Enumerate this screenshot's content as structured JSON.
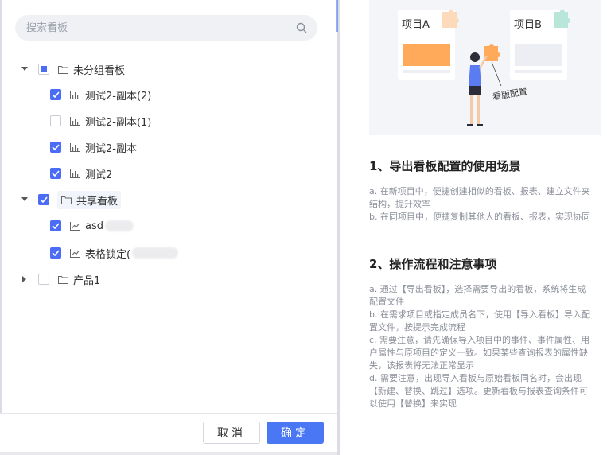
{
  "search": {
    "placeholder": "搜索看板"
  },
  "tree": {
    "groups": [
      {
        "label": "未分组看板",
        "items": [
          "测试2-副本(2)",
          "测试2-副本(1)",
          "测试2-副本",
          "测试2"
        ]
      },
      {
        "label": "共享看板",
        "items": [
          "asd",
          "表格锁定("
        ]
      },
      {
        "label": "产品1",
        "items": []
      }
    ]
  },
  "footer": {
    "cancel_label": "取消",
    "ok_label": "确定"
  },
  "illustration": {
    "card_a": "项目A",
    "card_b": "项目B",
    "caption": "看版配置"
  },
  "guide": {
    "section1_title": "1、导出看板配置的使用场景",
    "section1_lines": [
      "a. 在新项目中，便捷创建相似的看板、报表、建立文件夹结构，提升效率",
      "b. 在同项目中，便捷复制其他人的看板、报表，实现协同"
    ],
    "section2_title": "2、操作流程和注意事项",
    "section2_lines": [
      "a. 通过【导出看板】，选择需要导出的看板，系统将生成配置文件",
      "b. 在需求项目或指定成员名下，使用【导入看板】导入配置文件，按提示完成流程",
      "c. 需要注意，请先确保导入项目中的事件、事件属性、用户属性与原项目的定义一致。如果某些查询报表的属性缺失，该报表将无法正常显示",
      "d. 需要注意，出现导入看板与原始看板同名时，会出现【新建、替换、跳过】选项。更新看板与报表查询条件可以使用【替换】来实现"
    ]
  },
  "colors": {
    "accent": "#4a6cf7",
    "primary_button": "#4a78f5"
  }
}
